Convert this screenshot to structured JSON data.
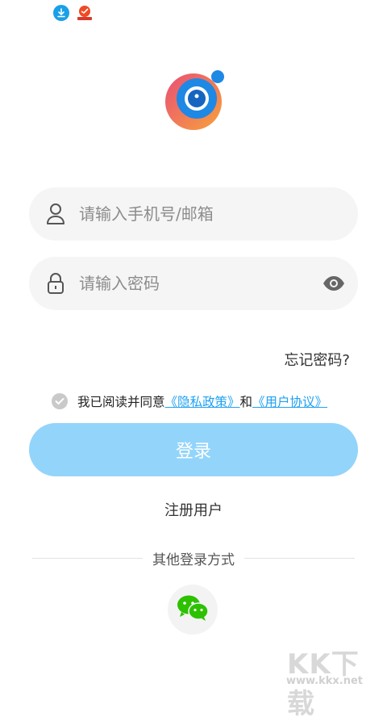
{
  "status": {
    "icons": [
      "download-icon",
      "app-notification-icon"
    ]
  },
  "logo": {
    "icon": "camera-lens-logo",
    "colors": [
      "#1e88e5",
      "#e94e77",
      "#f7a23b"
    ]
  },
  "login": {
    "phone_placeholder": "请输入手机号/邮箱",
    "password_placeholder": "请输入密码",
    "forgot": "忘记密码?",
    "agree_prefix": "我已阅读并同意",
    "privacy_link": "《隐私政策》",
    "and": "和",
    "terms_link": "《用户协议》",
    "login_button": "登录",
    "register": "注册用户",
    "other_methods": "其他登录方式"
  },
  "social": [
    {
      "icon": "wechat-icon",
      "color": "#2dc100"
    }
  ],
  "watermark": {
    "big": "KK下载",
    "small": "www.kkx.net"
  },
  "colors": {
    "accent": "#1fa1f2",
    "button": "#93d4fb",
    "field_bg": "#f5f5f5"
  }
}
